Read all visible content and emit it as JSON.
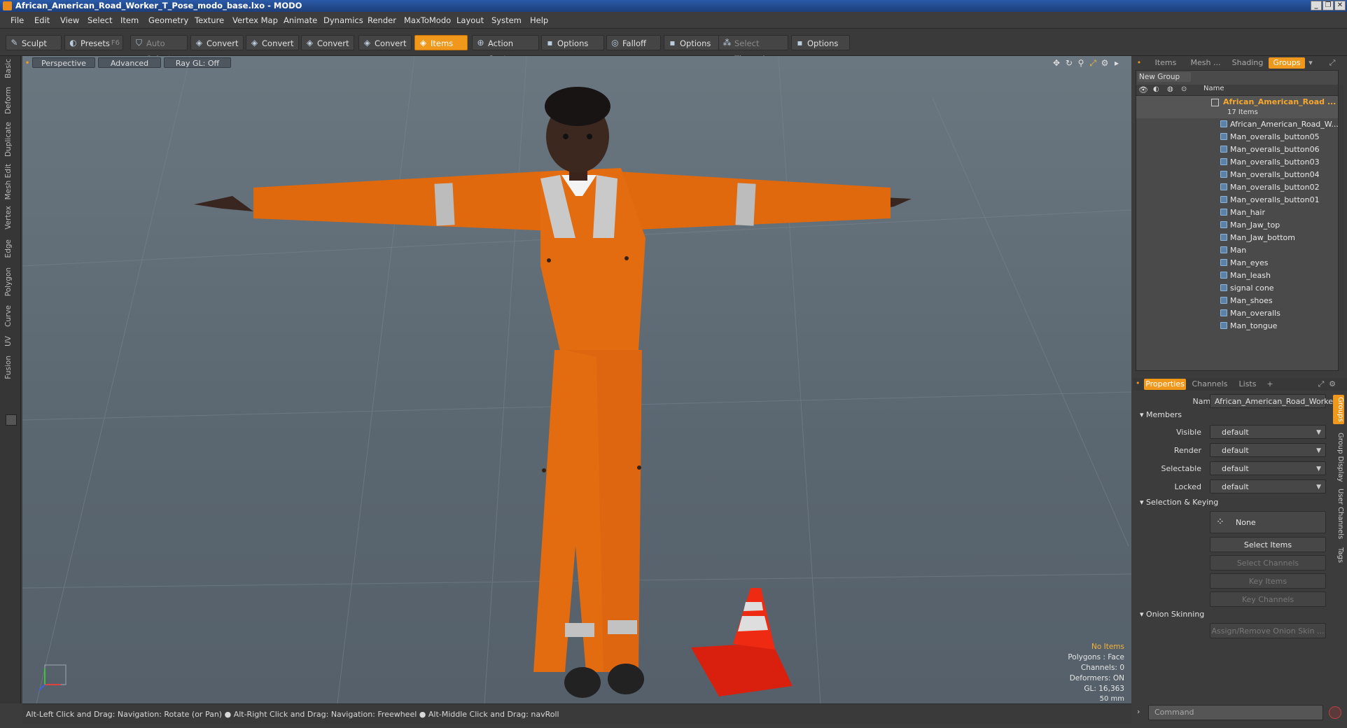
{
  "window": {
    "title": "African_American_Road_Worker_T_Pose_modo_base.lxo - MODO"
  },
  "menu": [
    "File",
    "Edit",
    "View",
    "Select",
    "Item",
    "Geometry",
    "Texture",
    "Vertex Map",
    "Animate",
    "Dynamics",
    "Render",
    "MaxToModo",
    "Layout",
    "System",
    "Help"
  ],
  "toolbar": {
    "sculpt": "Sculpt",
    "presets": "Presets",
    "presets_shortcut": "F6",
    "auto_select": "Auto Select",
    "convert1": "Convert",
    "convert2": "Convert",
    "convert3": "Convert",
    "convert4": "Convert",
    "items": "Items",
    "action_center": "Action Center",
    "options1": "Options",
    "falloff": "Falloff",
    "options2": "Options",
    "select_through": "Select Through",
    "options3": "Options"
  },
  "left_tabs": [
    "Basic",
    "Deform",
    "Duplicate",
    "Mesh Edit",
    "Vertex",
    "Edge",
    "Polygon",
    "Curve",
    "UV",
    "Fusion"
  ],
  "viewport": {
    "view_mode": "Perspective",
    "shading": "Advanced",
    "raygl": "Ray GL: Off",
    "info": {
      "no_items": "No Items",
      "polygons": "Polygons : Face",
      "channels": "Channels: 0",
      "deformers": "Deformers: ON",
      "gl": "GL: 16,363",
      "focal": "50 mm"
    }
  },
  "status": {
    "hint": "Alt-Left Click and Drag: Navigation: Rotate (or Pan) ● Alt-Right Click and Drag: Navigation: Freewheel ● Alt-Middle Click and Drag: navRoll"
  },
  "right_panel": {
    "tabs": [
      "Items",
      "Mesh ...",
      "Shading",
      "Groups"
    ],
    "active_tab": "Groups",
    "new_group": "New Group",
    "name_header": "Name",
    "group_name": "African_American_Road ...",
    "group_count": "17 Items",
    "items": [
      "African_American_Road_W...",
      "Man_overalls_button05",
      "Man_overalls_button06",
      "Man_overalls_button03",
      "Man_overalls_button04",
      "Man_overalls_button02",
      "Man_overalls_button01",
      "Man_hair",
      "Man_Jaw_top",
      "Man_Jaw_bottom",
      "Man",
      "Man_eyes",
      "Man_leash",
      "signal cone",
      "Man_shoes",
      "Man_overalls",
      "Man_tongue"
    ]
  },
  "properties": {
    "tabs": [
      "Properties",
      "Channels",
      "Lists"
    ],
    "name_label": "Name",
    "name_value": "African_American_Road_Worker",
    "members": "Members",
    "visible_label": "Visible",
    "render_label": "Render",
    "selectable_label": "Selectable",
    "locked_label": "Locked",
    "default_value": "default",
    "selection_keying": "Selection & Keying",
    "none": "None",
    "select_items": "Select Items",
    "select_channels": "Select Channels",
    "key_items": "Key Items",
    "key_channels": "Key Channels",
    "onion_skinning": "Onion Skinning",
    "assign_onion": "Assign/Remove Onion Skin ...",
    "side_tabs": [
      "Groups",
      "Group Display",
      "User Channels",
      "Tags"
    ]
  },
  "command": {
    "placeholder": "Command"
  }
}
